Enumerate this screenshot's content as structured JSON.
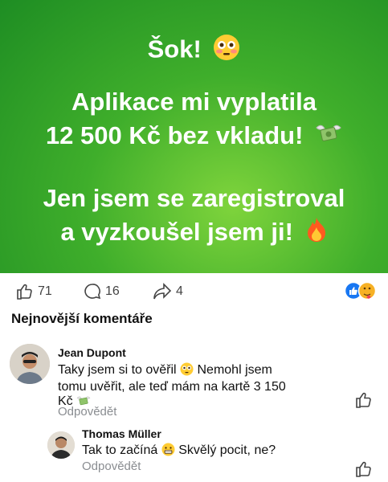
{
  "banner": {
    "line1": "Šok!",
    "line2": "Aplikace mi vyplatila",
    "line3": "12 500 Kč bez vkladu!",
    "line4": "Jen jsem se zaregistroval",
    "line5": "a vyzkoušel jsem ji!"
  },
  "stats": {
    "likes": "71",
    "comments": "16",
    "shares": "4"
  },
  "comments_section": {
    "title": "Nejnovější komentáře"
  },
  "comments": [
    {
      "author": "Jean Dupont",
      "text_line1": "Taky jsem si to ověřil",
      "text_line1b": "Nemohl jsem",
      "text_line2": "tomu uvěřit, ale teď mám na kartě 3 150",
      "text_line3": "Kč",
      "reply_label": "Odpovědět"
    },
    {
      "author": "Thomas Müller",
      "text_a": "Tak to začíná",
      "text_b": "Skvělý pocit, ne?",
      "reply_label": "Odpovědět"
    }
  ],
  "colors": {
    "banner_green": "#3fae2b",
    "like_blue": "#1877f2",
    "love_red": "#f33e58"
  }
}
